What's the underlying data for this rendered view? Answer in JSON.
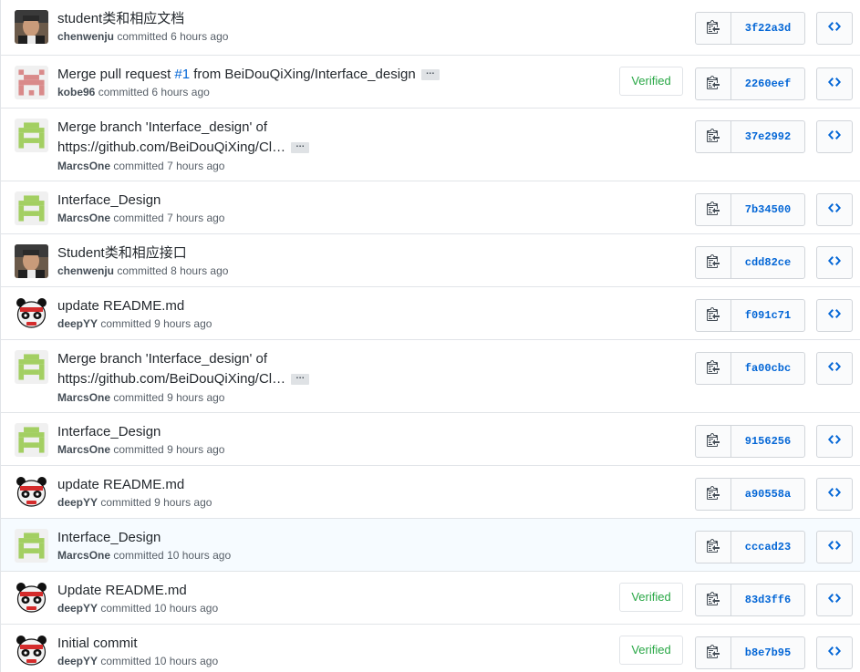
{
  "colors": {
    "link": "#0366d6",
    "verified": "#28a745",
    "border": "#e1e4e8",
    "highlight": "#f6fbff"
  },
  "icons": {
    "copy": "clipboard-icon",
    "browse": "code-icon",
    "expand": "ellipsis-icon"
  },
  "commits": [
    {
      "message": "student类和相应文档",
      "author": "chenwenju",
      "verb": "committed",
      "time": "6 hours ago",
      "sha": "3f22a3d",
      "avatar": "photo",
      "verified": ""
    },
    {
      "message": "Merge pull request ",
      "issue": "#1",
      "message_rest": " from BeiDouQiXing/Interface_design",
      "expandable": true,
      "author": "kobe96",
      "verb": "committed",
      "time": "6 hours ago",
      "sha": "2260eef",
      "avatar": "identicon-red",
      "verified": "Verified"
    },
    {
      "message": "Merge branch 'Interface_design' of",
      "message_line2": "https://github.com/BeiDouQiXing/Cl…",
      "expandable": true,
      "author": "MarcsOne",
      "verb": "committed",
      "time": "7 hours ago",
      "sha": "37e2992",
      "avatar": "identicon-green",
      "verified": ""
    },
    {
      "message": "Interface_Design",
      "author": "MarcsOne",
      "verb": "committed",
      "time": "7 hours ago",
      "sha": "7b34500",
      "avatar": "identicon-green",
      "verified": ""
    },
    {
      "message": "Student类和相应接口",
      "author": "chenwenju",
      "verb": "committed",
      "time": "8 hours ago",
      "sha": "cdd82ce",
      "avatar": "photo",
      "verified": ""
    },
    {
      "message": "update README.md",
      "author": "deepYY",
      "verb": "committed",
      "time": "9 hours ago",
      "sha": "f091c71",
      "avatar": "panda",
      "verified": ""
    },
    {
      "message": "Merge branch 'Interface_design' of",
      "message_line2": "https://github.com/BeiDouQiXing/Cl…",
      "expandable": true,
      "author": "MarcsOne",
      "verb": "committed",
      "time": "9 hours ago",
      "sha": "fa00cbc",
      "avatar": "identicon-green",
      "verified": ""
    },
    {
      "message": "Interface_Design",
      "author": "MarcsOne",
      "verb": "committed",
      "time": "9 hours ago",
      "sha": "9156256",
      "avatar": "identicon-green",
      "verified": ""
    },
    {
      "message": "update README.md",
      "author": "deepYY",
      "verb": "committed",
      "time": "9 hours ago",
      "sha": "a90558a",
      "avatar": "panda",
      "verified": ""
    },
    {
      "message": "Interface_Design",
      "author": "MarcsOne",
      "verb": "committed",
      "time": "10 hours ago",
      "sha": "cccad23",
      "avatar": "identicon-green",
      "verified": "",
      "highlighted": true
    },
    {
      "message": "Update README.md",
      "author": "deepYY",
      "verb": "committed",
      "time": "10 hours ago",
      "sha": "83d3ff6",
      "avatar": "panda",
      "verified": "Verified"
    },
    {
      "message": "Initial commit",
      "author": "deepYY",
      "verb": "committed",
      "time": "10 hours ago",
      "sha": "b8e7b95",
      "avatar": "panda",
      "verified": "Verified"
    }
  ]
}
